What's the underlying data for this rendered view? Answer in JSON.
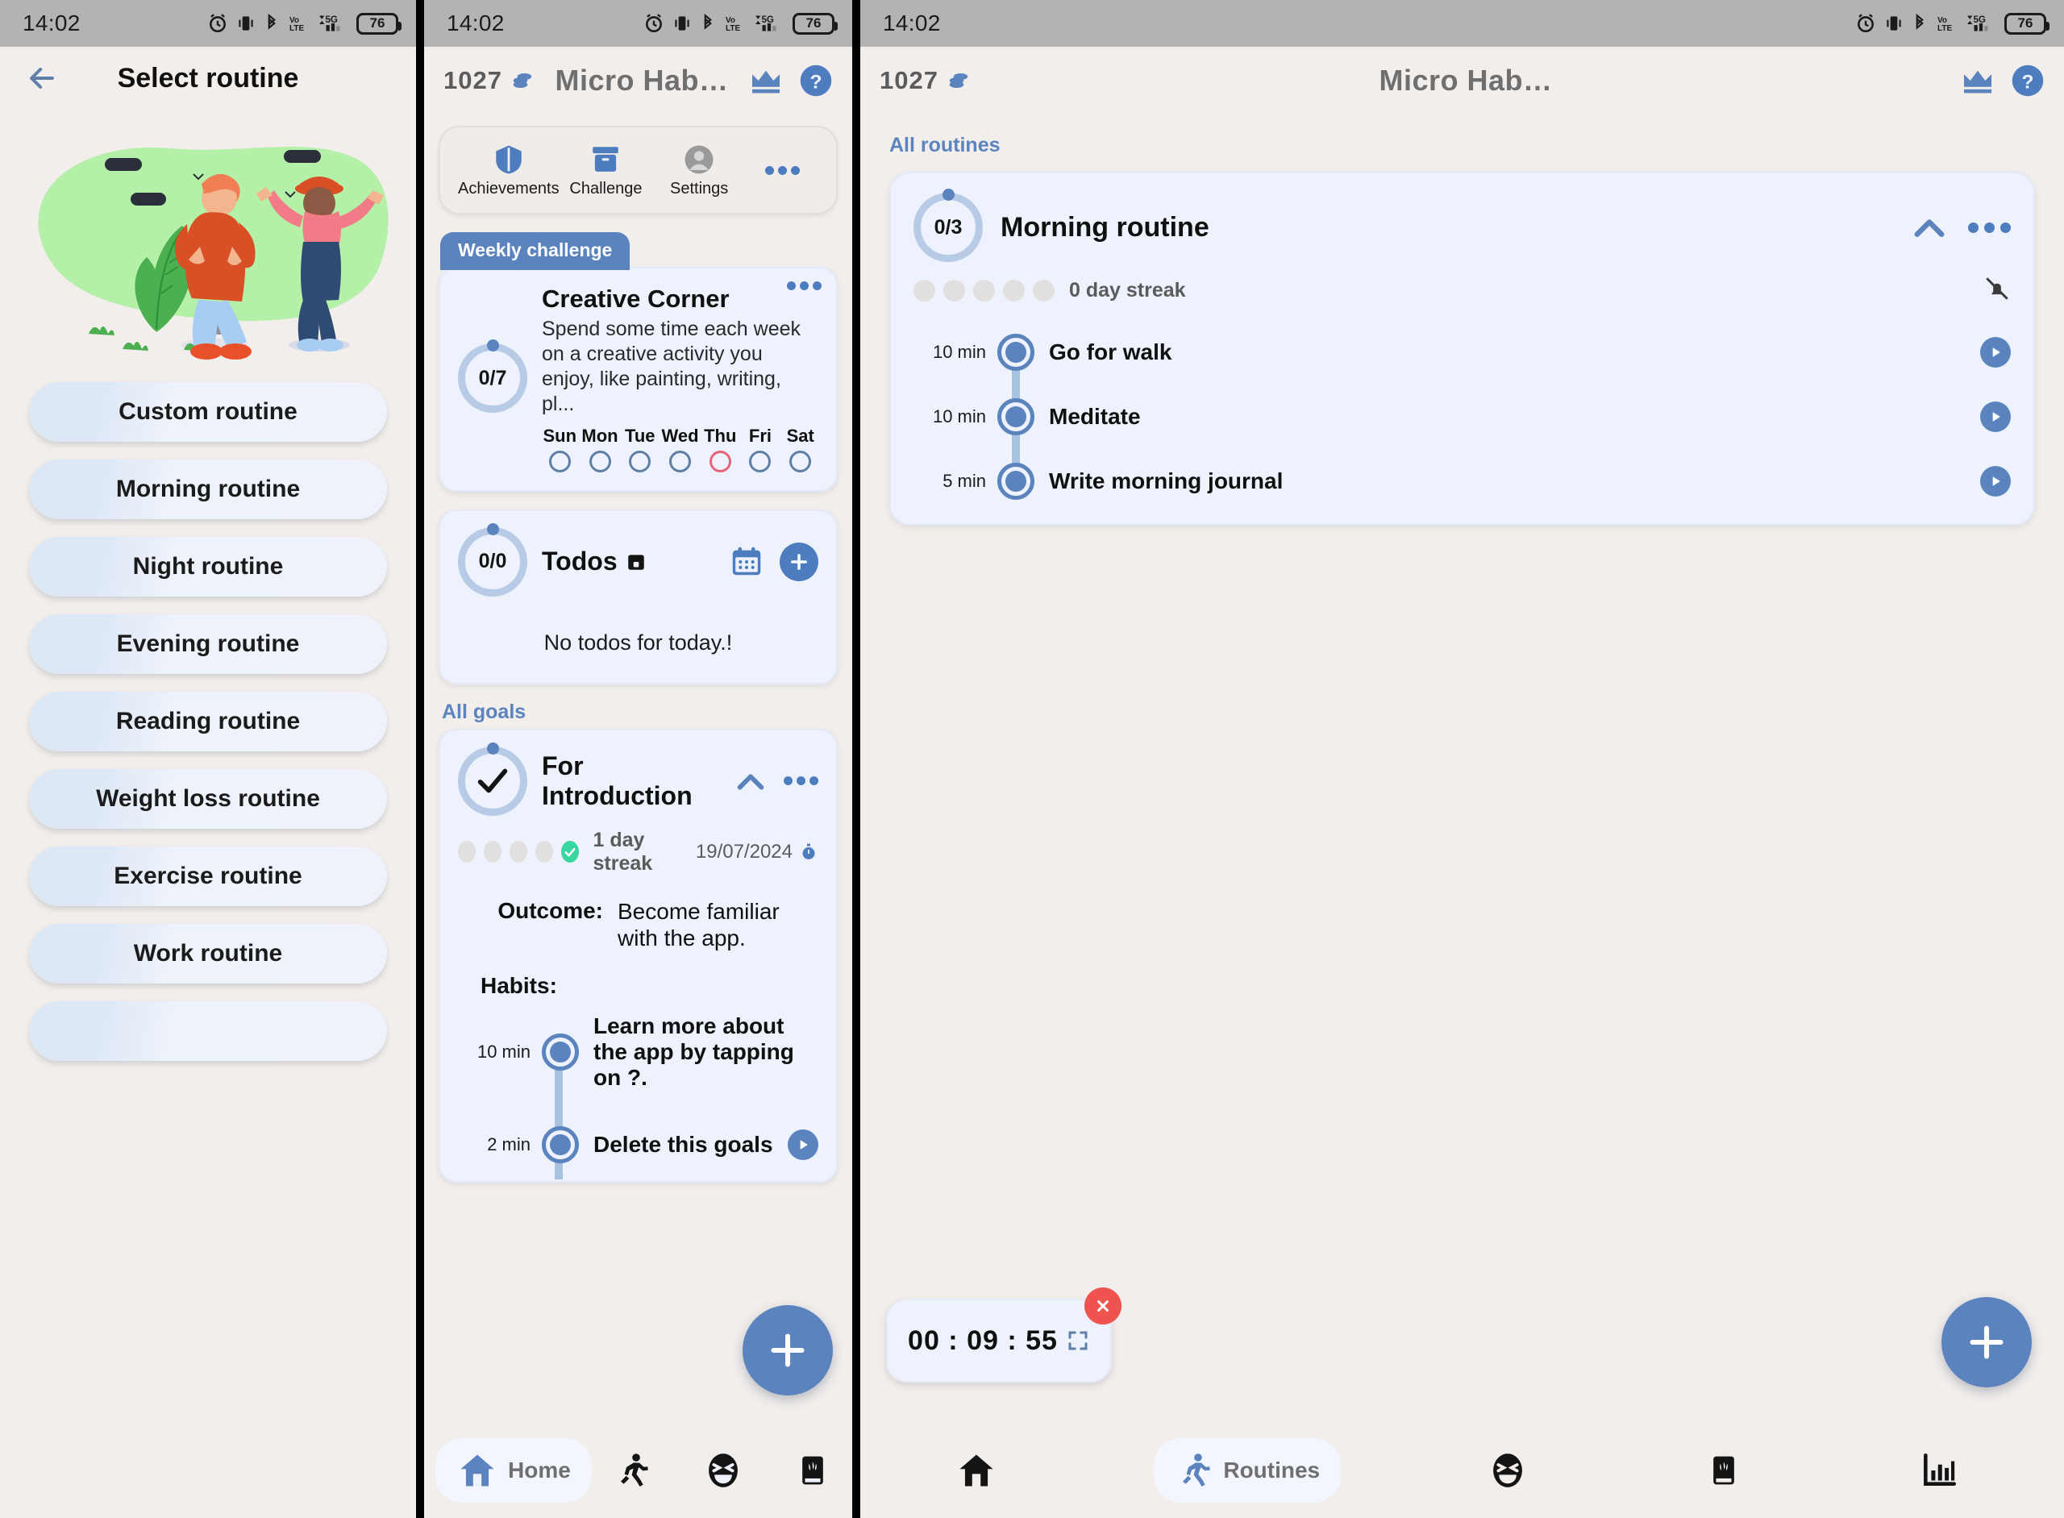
{
  "status_bar": {
    "time": "14:02",
    "battery": "76",
    "icons": [
      "alarm-icon",
      "vibrate-icon",
      "bluetooth-icon",
      "volte-icon",
      "signal-5g-icon",
      "battery-icon"
    ]
  },
  "panel_select_routine": {
    "title": "Select routine",
    "back_icon": "back-arrow-icon",
    "routines": [
      {
        "label": "Custom routine"
      },
      {
        "label": "Morning routine"
      },
      {
        "label": "Night routine"
      },
      {
        "label": "Evening routine"
      },
      {
        "label": "Reading routine"
      },
      {
        "label": "Weight loss routine"
      },
      {
        "label": "Exercise routine"
      },
      {
        "label": "Work routine"
      }
    ]
  },
  "panel_home": {
    "coins": "1027",
    "app_title": "Micro Hab…",
    "crown_icon": "crown-icon",
    "help_icon": "help-icon",
    "action_bar": [
      {
        "label": "Achievements",
        "icon": "shield-icon"
      },
      {
        "label": "Challenge",
        "icon": "box-icon"
      },
      {
        "label": "Settings",
        "icon": "avatar-icon"
      }
    ],
    "action_more_icon": "more-dots-icon",
    "weekly_challenge": {
      "badge": "Weekly challenge",
      "progress": "0/7",
      "title": "Creative Corner",
      "description": "Spend some time each week on a creative activity you enjoy, like painting, writing, pl...",
      "days": [
        "Sun",
        "Mon",
        "Tue",
        "Wed",
        "Thu",
        "Fri",
        "Sat"
      ],
      "today": "Thu",
      "more_icon": "more-dots-icon"
    },
    "todos": {
      "progress": "0/0",
      "title": "Todos",
      "title_icon": "calendar-small-icon",
      "calendar_icon": "calendar-icon",
      "add_icon": "plus-icon",
      "empty_text": "No todos for today.!"
    },
    "all_goals_label": "All goals",
    "goal": {
      "title": "For Introduction",
      "check_icon": "check-icon",
      "collapse_icon": "chevron-up-icon",
      "more_icon": "more-dots-icon",
      "streak": "1 day streak",
      "date": "19/07/2024",
      "date_icon": "stopwatch-icon",
      "outcome_label": "Outcome:",
      "outcome_value": "Become familiar with the app.",
      "habits_label": "Habits:",
      "habits": [
        {
          "duration": "10 min",
          "name": "Learn more about the app by tapping on ?."
        },
        {
          "duration": "2 min",
          "name": "Delete this goals"
        }
      ]
    },
    "fab_icon": "plus-icon",
    "bottom_nav": [
      {
        "label": "Home",
        "icon": "home-icon",
        "active": true
      },
      {
        "label": "",
        "icon": "running-icon",
        "active": false
      },
      {
        "label": "",
        "icon": "laughing-face-icon",
        "active": false
      },
      {
        "label": "",
        "icon": "book-icon",
        "active": false
      },
      {
        "label": "",
        "icon": "chart-icon",
        "active": false
      }
    ]
  },
  "panel_routines": {
    "coins": "1027",
    "app_title": "Micro Hab…",
    "crown_icon": "crown-icon",
    "help_icon": "help-icon",
    "all_routines_label": "All routines",
    "routine": {
      "progress": "0/3",
      "title": "Morning routine",
      "collapse_icon": "chevron-up-icon",
      "more_icon": "more-dots-icon",
      "streak": "0 day streak",
      "bell_icon": "bell-off-icon",
      "habits": [
        {
          "duration": "10 min",
          "name": "Go for walk",
          "play_icon": "play-icon"
        },
        {
          "duration": "10 min",
          "name": "Meditate",
          "play_icon": "play-icon"
        },
        {
          "duration": "5 min",
          "name": "Write morning journal",
          "play_icon": "play-icon"
        }
      ]
    },
    "timer": {
      "value": "00 : 09 : 55",
      "close_icon": "close-icon",
      "expand_icon": "expand-icon"
    },
    "fab_icon": "plus-icon",
    "bottom_nav": [
      {
        "label": "",
        "icon": "home-icon",
        "active": false
      },
      {
        "label": "Routines",
        "icon": "running-icon",
        "active": true
      },
      {
        "label": "",
        "icon": "laughing-face-icon",
        "active": false
      },
      {
        "label": "",
        "icon": "book-icon",
        "active": false
      },
      {
        "label": "",
        "icon": "chart-icon",
        "active": false
      }
    ]
  },
  "colors": {
    "accent_blue": "#5b83bd",
    "card_bg": "#eef2fc",
    "page_bg": "#f2eeec",
    "today_red": "#e8637a",
    "streak_green": "#3ad6a0",
    "close_red": "#ef5350"
  }
}
